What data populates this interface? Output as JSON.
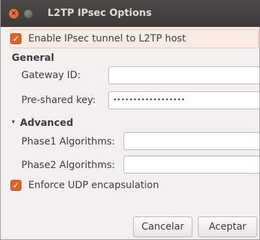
{
  "window": {
    "title": "L2TP IPsec Options"
  },
  "ipsec_enable": {
    "label": "Enable IPsec tunnel to L2TP host",
    "checked": true
  },
  "general": {
    "heading": "General",
    "gateway_id_label": "Gateway ID:",
    "gateway_id_value": "",
    "psk_label": "Pre-shared key:",
    "psk_value": "••••••••••••••••••"
  },
  "advanced": {
    "heading": "Advanced",
    "expander_icon": "▾",
    "phase1_label": "Phase1 Algorithms:",
    "phase1_value": "",
    "phase2_label": "Phase2 Algorithms:",
    "phase2_value": ""
  },
  "udp_encap": {
    "label": "Enforce UDP encapsulation",
    "checked": true
  },
  "buttons": {
    "cancel": "Cancelar",
    "accept": "Aceptar"
  },
  "colors": {
    "accent": "#d8652f",
    "titlebar": "#3c3b37"
  }
}
